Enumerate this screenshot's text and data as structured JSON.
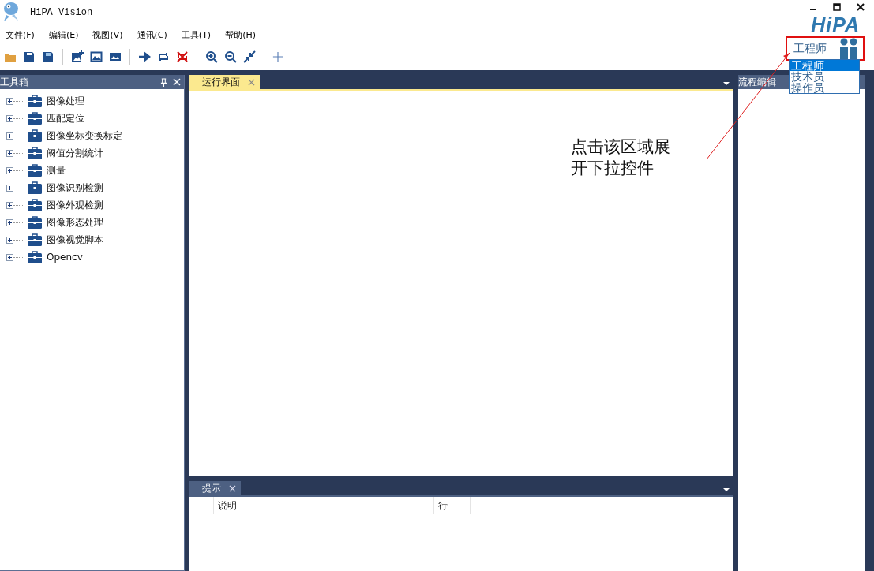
{
  "window": {
    "title": "HiPA Vision",
    "logo": "HiPA"
  },
  "menu": [
    "文件(F)",
    "编辑(E)",
    "视图(V)",
    "通讯(C)",
    "工具(T)",
    "帮助(H)"
  ],
  "role_selector": {
    "value": "工程师",
    "expanded": true,
    "options": [
      {
        "label": "工程师",
        "selected": true
      },
      {
        "label": "技术员",
        "selected": false
      },
      {
        "label": "操作员",
        "selected": false
      }
    ]
  },
  "toolbox": {
    "title": "工具箱",
    "items": [
      {
        "label": "图像处理",
        "expanded": false
      },
      {
        "label": "匹配定位",
        "expanded": false
      },
      {
        "label": "图像坐标变换标定",
        "expanded": false
      },
      {
        "label": "阈值分割统计",
        "expanded": false
      },
      {
        "label": "测量",
        "expanded": false
      },
      {
        "label": "图像识别检测",
        "expanded": false
      },
      {
        "label": "图像外观检测",
        "expanded": false
      },
      {
        "label": "图像形态处理",
        "expanded": false
      },
      {
        "label": "图像视觉脚本",
        "expanded": false
      },
      {
        "label": "Opencv",
        "expanded": false
      }
    ]
  },
  "document_tab": {
    "label": "运行界面",
    "selected": true
  },
  "hint_panel": {
    "tab": {
      "label": "提示",
      "selected": false
    },
    "columns": [
      "说明",
      "行"
    ]
  },
  "flow_panel": {
    "title": "流程编辑"
  },
  "annotation": {
    "text": "点击该区域展开下拉控件"
  }
}
